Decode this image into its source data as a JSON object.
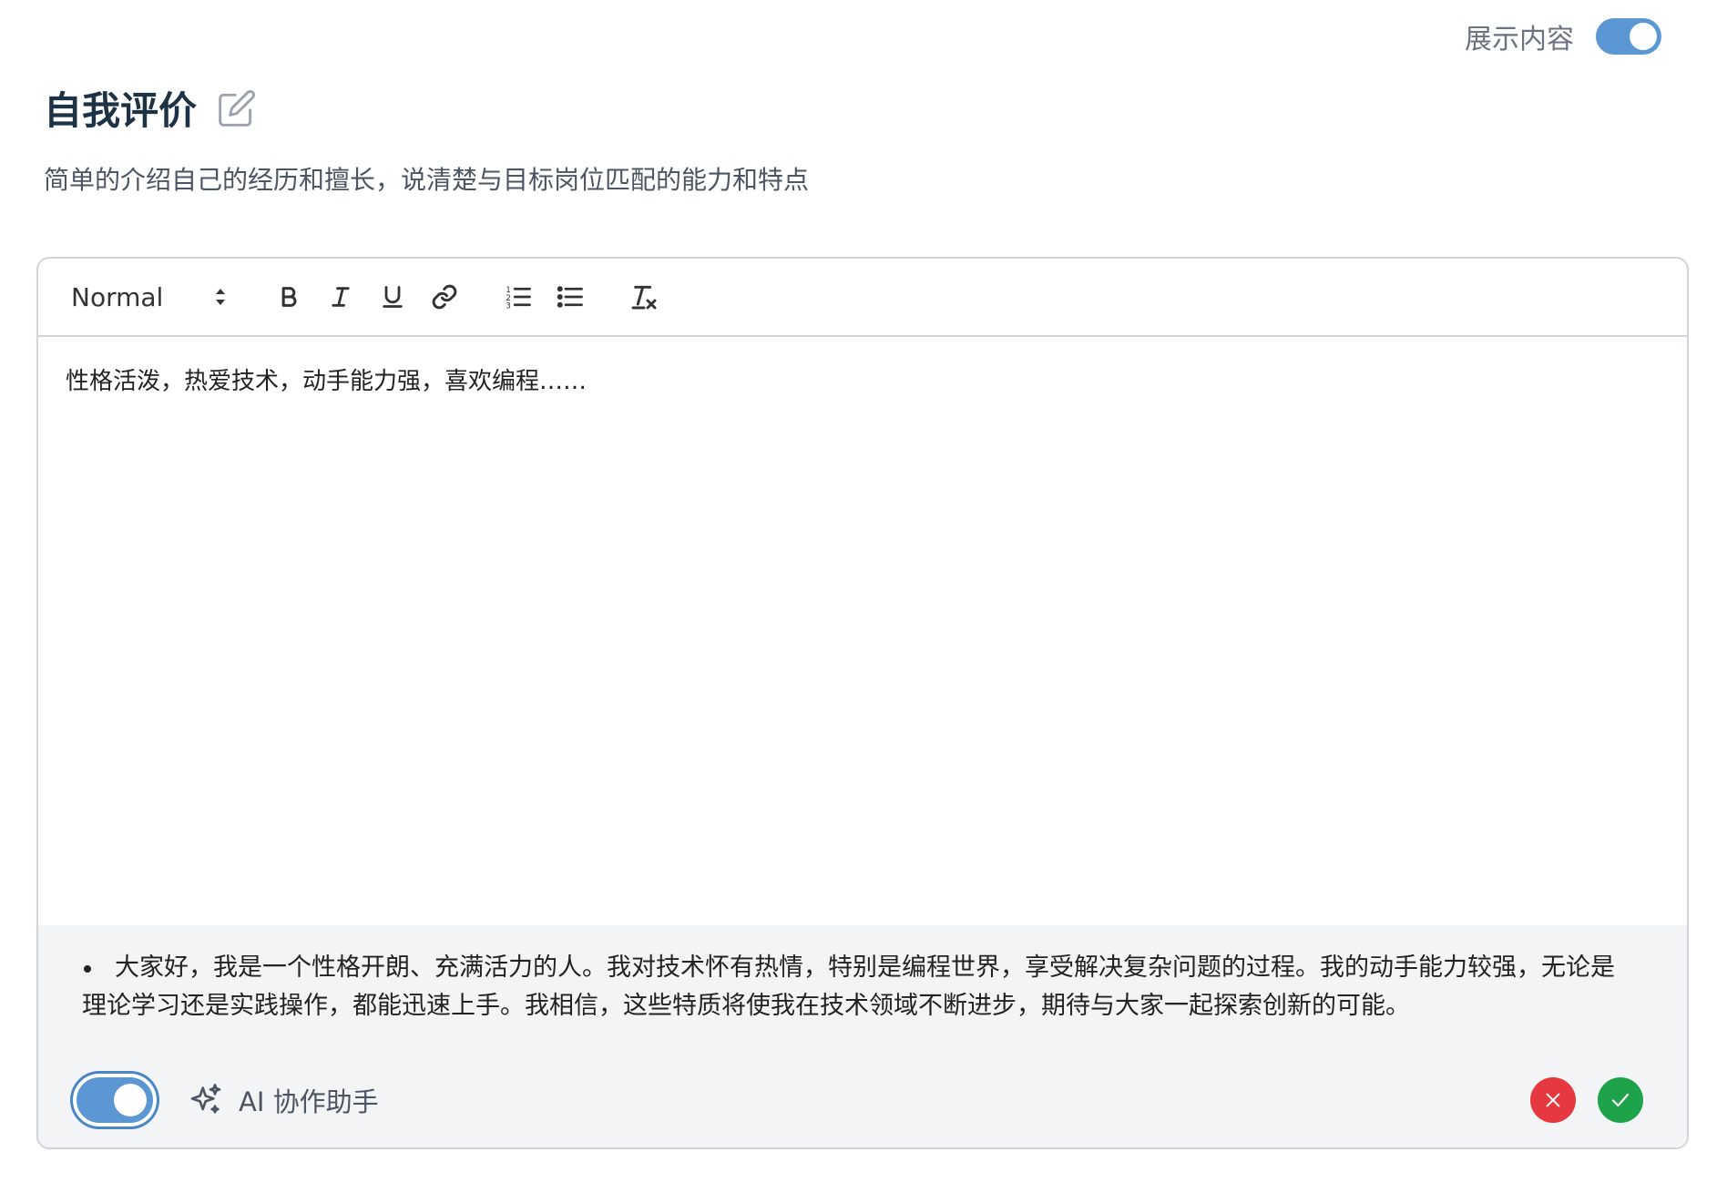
{
  "header": {
    "show_label": "展示内容",
    "show_toggle_on": true
  },
  "section": {
    "title": "自我评价",
    "subtitle": "简单的介绍自己的经历和擅长，说清楚与目标岗位匹配的能力和特点"
  },
  "toolbar": {
    "format_value": "Normal",
    "buttons": [
      "bold-icon",
      "italic-icon",
      "underline-icon",
      "link-icon",
      "ordered-list-icon",
      "bullet-list-icon",
      "clear-format-icon"
    ]
  },
  "editor": {
    "content": "性格活泼，热爱技术，动手能力强，喜欢编程……"
  },
  "ai": {
    "suggestion": "大家好，我是一个性格开朗、充满活力的人。我对技术怀有热情，特别是编程世界，享受解决复杂问题的过程。我的动手能力较强，无论是理论学习还是实践操作，都能迅速上手。我相信，这些特质将使我在技术领域不断进步，期待与大家一起探索创新的可能。",
    "label": "AI 协作助手",
    "toggle_on": true
  },
  "colors": {
    "accent": "#5b97d2",
    "reject": "#e5393f",
    "accept": "#1fa34a",
    "title": "#1e3246"
  }
}
